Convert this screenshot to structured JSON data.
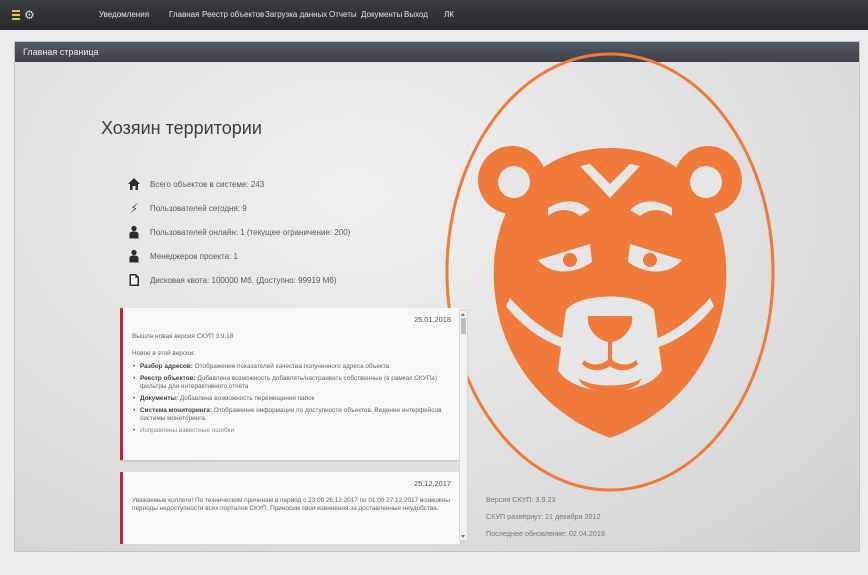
{
  "nav": {
    "items": [
      "Уведомления",
      "Главная",
      "Реестр объектов",
      "Загрузка данных",
      "Отчеты",
      "Документы",
      "Выход",
      "ЛК"
    ]
  },
  "panel": {
    "header": "Главная страница",
    "title": "Хозяин территории"
  },
  "stats": [
    {
      "icon": "home-icon",
      "text": "Всего объектов в системе: 243"
    },
    {
      "icon": "lightning-icon",
      "text": "Пользователей сегодня: 9"
    },
    {
      "icon": "user-icon",
      "text": "Пользователей онлайн: 1 (текущее ограничение: 200)"
    },
    {
      "icon": "user-icon",
      "text": "Менеджеров проекта: 1"
    },
    {
      "icon": "document-icon",
      "text": "Дисковая квота: 100000 Мб. (Доступно: 99919 Мб)"
    }
  ],
  "news": [
    {
      "date": "25.01.2018",
      "headline": "Вышла новая версия СКУП 3.9.18",
      "intro": "Новое в этой версии:",
      "items": [
        {
          "label": "Разбор адресов:",
          "text": "Отображение показателей качества полученного адреса объекта"
        },
        {
          "label": "Реестр объектов:",
          "text": "Добавлена возможность добавлять/настраивать собственные (в рамках СКУПа) фильтры для интерактивного отчета"
        },
        {
          "label": "Документы:",
          "text": "Добавлена возможность перемещения папок"
        },
        {
          "label": "Система мониторинга:",
          "text": "Отображение информации по доступности объектов. Ведение интерфейсов системы мониторинга."
        },
        {
          "label": "",
          "text": "Исправлены известные ошибки"
        }
      ]
    },
    {
      "date": "25.12.2017",
      "text": "Уважаемые коллеги! По техническим причинам в период с 23:00 26.12.2017 по 01:00 27.12.2017 возможны периоды недоступности всех порталов СКУП. Приносим свои извинения за доставленные неудобства."
    }
  ],
  "version": {
    "version": "Версия СКУП: 3.9.23",
    "deployed": "СКУП развёрнут: 21 декабря 2012",
    "updated": "Последнее обновление: 02.04.2019"
  },
  "colors": {
    "accent": "#f07a3a",
    "news_border": "#c8203a",
    "header": "#464c54"
  }
}
